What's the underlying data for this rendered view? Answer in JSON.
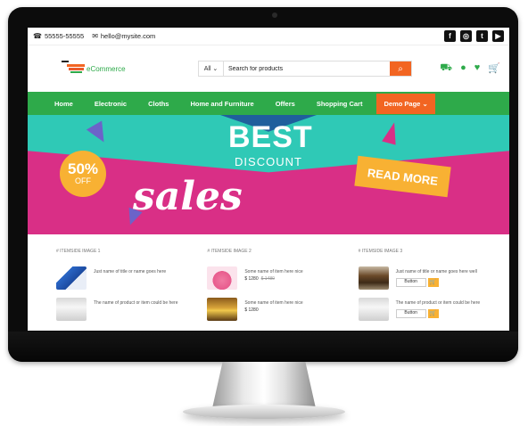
{
  "topbar": {
    "phone": "55555-55555",
    "email": "hello@mysite.com",
    "social_icons": [
      "facebook-icon",
      "instagram-icon",
      "twitter-icon",
      "youtube-icon"
    ]
  },
  "header": {
    "logo_text": "eCommerce",
    "search_category": "All",
    "search_placeholder": "Search for products",
    "icons": [
      "truck-icon",
      "user-icon",
      "heart-icon",
      "cart-icon"
    ]
  },
  "nav": {
    "items": [
      "Home",
      "Electronic",
      "Cloths",
      "Home and Furniture",
      "Offers",
      "Shopping Cart",
      "Demo Page"
    ]
  },
  "banner": {
    "headline": "BEST",
    "subhead": "DISCOUNT",
    "discount": "50%",
    "off": "OFF",
    "script": "sales",
    "cta": "READ MORE"
  },
  "products": [
    {
      "title": "# ITEMSIDE IMAGE 1",
      "items": [
        {
          "name": "Just name of title or name goes here"
        },
        {
          "name": "The name of product or item could be here"
        }
      ]
    },
    {
      "title": "# ITEMSIDE IMAGE 2",
      "items": [
        {
          "name": "Some name of item here nice",
          "price": "$ 1280",
          "old_price": "$ 1480"
        },
        {
          "name": "Some name of item here nice",
          "price": "$ 1280"
        }
      ]
    },
    {
      "title": "# ITEMSIDE IMAGE 3",
      "items": [
        {
          "name": "Just name of title or name goes here well",
          "button": "Button"
        },
        {
          "name": "The name of product or item could be here",
          "button": "Button"
        }
      ]
    }
  ],
  "colors": {
    "green": "#2eaa4a",
    "orange": "#f26522",
    "pink": "#d92f86",
    "teal": "#2fc9b6",
    "yellow": "#f8b133"
  }
}
